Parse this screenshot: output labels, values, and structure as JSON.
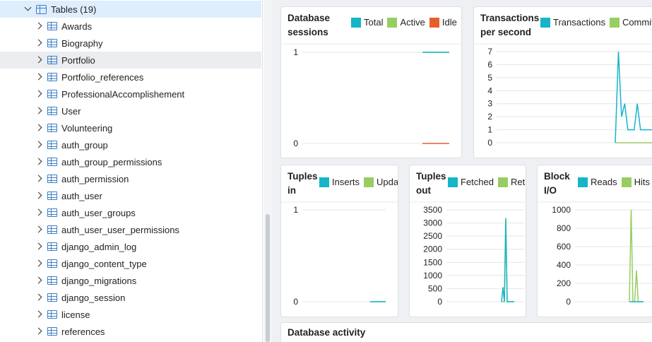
{
  "sidebar": {
    "group": {
      "label": "Tables (19)"
    },
    "items": [
      "Awards",
      "Biography",
      "Portfolio",
      "Portfolio_references",
      "ProfessionalAccomplishement",
      "User",
      "Volunteering",
      "auth_group",
      "auth_group_permissions",
      "auth_permission",
      "auth_user",
      "auth_user_groups",
      "auth_user_user_permissions",
      "django_admin_log",
      "django_content_type",
      "django_migrations",
      "django_session",
      "license",
      "references"
    ],
    "hovered_item": "Portfolio"
  },
  "colors": {
    "teal": "#16b5c8",
    "green": "#98cd61",
    "orange": "#e95d2b"
  },
  "cards": {
    "sessions": {
      "title_l1": "Database",
      "title_l2": "sessions",
      "legend": [
        "Total",
        "Active",
        "Idle"
      ]
    },
    "tps": {
      "title_l1": "Transactions",
      "title_l2": "per second",
      "legend": [
        "Transactions",
        "Commits"
      ]
    },
    "tuples_in": {
      "title_l1": "Tuples",
      "title_l2": "in",
      "legend": [
        "Inserts",
        "Updates"
      ]
    },
    "tuples_out": {
      "title_l1": "Tuples",
      "title_l2": "out",
      "legend": [
        "Fetched",
        "Returned"
      ]
    },
    "block_io": {
      "title_l1": "Block",
      "title_l2": "I/O",
      "legend": [
        "Reads",
        "Hits"
      ]
    },
    "activity": {
      "title": "Database activity"
    }
  },
  "chart_data": [
    {
      "type": "line",
      "title": "Database sessions",
      "ylim": [
        0,
        1
      ],
      "yticks": [
        "0",
        "1"
      ],
      "x": [
        0,
        1,
        2,
        3,
        4,
        5,
        6,
        7,
        8,
        9,
        10
      ],
      "series": [
        {
          "name": "Total",
          "values": [
            1,
            1,
            1,
            1,
            1,
            1,
            1,
            1,
            1,
            1,
            1
          ]
        },
        {
          "name": "Active",
          "values": [
            1,
            1,
            1,
            1,
            1,
            1,
            1,
            1,
            1,
            1,
            1
          ]
        },
        {
          "name": "Idle",
          "values": [
            0,
            0,
            0,
            0,
            0,
            0,
            0,
            0,
            0,
            0,
            0
          ]
        }
      ]
    },
    {
      "type": "line",
      "title": "Transactions per second",
      "ylim": [
        0,
        7
      ],
      "yticks": [
        "0",
        "1",
        "2",
        "3",
        "4",
        "5",
        "6",
        "7"
      ],
      "x": [
        0,
        1,
        2,
        3,
        4,
        5,
        6,
        7,
        8,
        9,
        10,
        11,
        12,
        13
      ],
      "series": [
        {
          "name": "Transactions",
          "values": [
            0,
            7,
            2,
            3,
            1,
            1,
            1,
            3,
            1,
            1,
            1,
            1,
            1,
            1
          ]
        },
        {
          "name": "Commits",
          "values": [
            0,
            0,
            0,
            0,
            0,
            0,
            0,
            0,
            0,
            0,
            0,
            0,
            0,
            0
          ]
        }
      ]
    },
    {
      "type": "line",
      "title": "Tuples in",
      "ylim": [
        0,
        1
      ],
      "yticks": [
        "0",
        "1"
      ],
      "x": [
        0,
        1,
        2,
        3
      ],
      "series": [
        {
          "name": "Inserts",
          "values": [
            0,
            0,
            0,
            0
          ]
        },
        {
          "name": "Updates",
          "values": [
            0,
            0,
            0,
            0
          ]
        }
      ]
    },
    {
      "type": "line",
      "title": "Tuples out",
      "ylim": [
        0,
        3500
      ],
      "yticks": [
        "0",
        "500",
        "1000",
        "1500",
        "2000",
        "2500",
        "3000",
        "3500"
      ],
      "x": [
        0,
        1,
        2,
        3,
        4,
        5,
        6,
        7,
        8,
        9
      ],
      "series": [
        {
          "name": "Fetched",
          "values": [
            0,
            550,
            0,
            3150,
            0,
            0,
            0,
            0,
            0,
            0
          ]
        },
        {
          "name": "Returned",
          "values": [
            0,
            0,
            0,
            3200,
            0,
            0,
            0,
            0,
            0,
            0
          ]
        }
      ]
    },
    {
      "type": "line",
      "title": "Block I/O",
      "ylim": [
        0,
        1000
      ],
      "yticks": [
        "0",
        "200",
        "400",
        "600",
        "800",
        "1000"
      ],
      "x": [
        0,
        1,
        2,
        3,
        4,
        5,
        6,
        7,
        8
      ],
      "series": [
        {
          "name": "Reads",
          "values": [
            0,
            0,
            0,
            0,
            0,
            0,
            0,
            0,
            0
          ]
        },
        {
          "name": "Hits",
          "values": [
            0,
            1000,
            0,
            0,
            340,
            0,
            0,
            0,
            0
          ]
        }
      ]
    }
  ]
}
